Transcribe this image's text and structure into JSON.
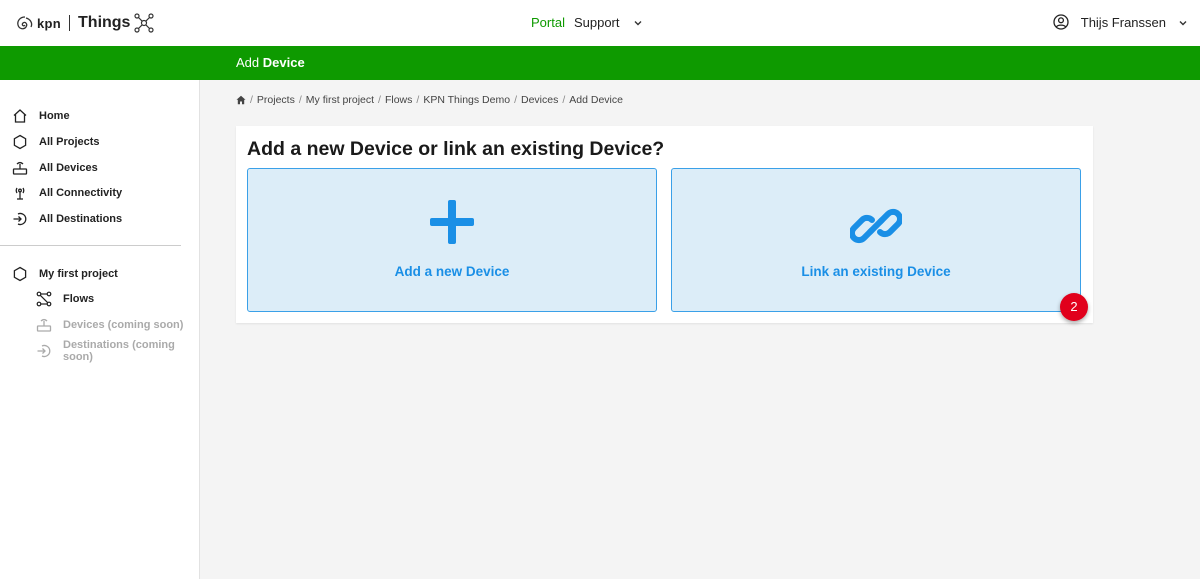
{
  "header": {
    "logo_brand": "kpn",
    "logo_product": "Things",
    "nav": {
      "portal": "Portal",
      "support": "Support"
    },
    "user_name": "Thijs Franssen"
  },
  "page_header": {
    "prefix": "Add",
    "title": "Device"
  },
  "sidebar": {
    "items": [
      {
        "label": "Home",
        "icon": "home-icon"
      },
      {
        "label": "All Projects",
        "icon": "hexagon-icon"
      },
      {
        "label": "All Devices",
        "icon": "device-icon"
      },
      {
        "label": "All Connectivity",
        "icon": "antenna-icon"
      },
      {
        "label": "All Destinations",
        "icon": "destination-icon"
      }
    ],
    "project": {
      "label": "My first project",
      "icon": "hexagon-icon",
      "children": [
        {
          "label": "Flows",
          "icon": "flows-icon",
          "enabled": true
        },
        {
          "label": "Devices (coming soon)",
          "icon": "device-icon",
          "enabled": false
        },
        {
          "label": "Destinations (coming soon)",
          "icon": "destination-icon",
          "enabled": false
        }
      ]
    }
  },
  "breadcrumb": [
    "Projects",
    "My first project",
    "Flows",
    "KPN Things Demo",
    "Devices",
    "Add Device"
  ],
  "main": {
    "heading": "Add a new Device or link an existing Device?",
    "options": [
      {
        "label": "Add a new Device",
        "icon": "plus-icon"
      },
      {
        "label": "Link an existing Device",
        "icon": "link-icon"
      }
    ]
  },
  "badge": {
    "count": "2"
  },
  "colors": {
    "brand_green": "#0e9a00",
    "accent_blue": "#1a8fe6",
    "option_bg": "#dcedf8",
    "badge_red": "#e1001c"
  }
}
